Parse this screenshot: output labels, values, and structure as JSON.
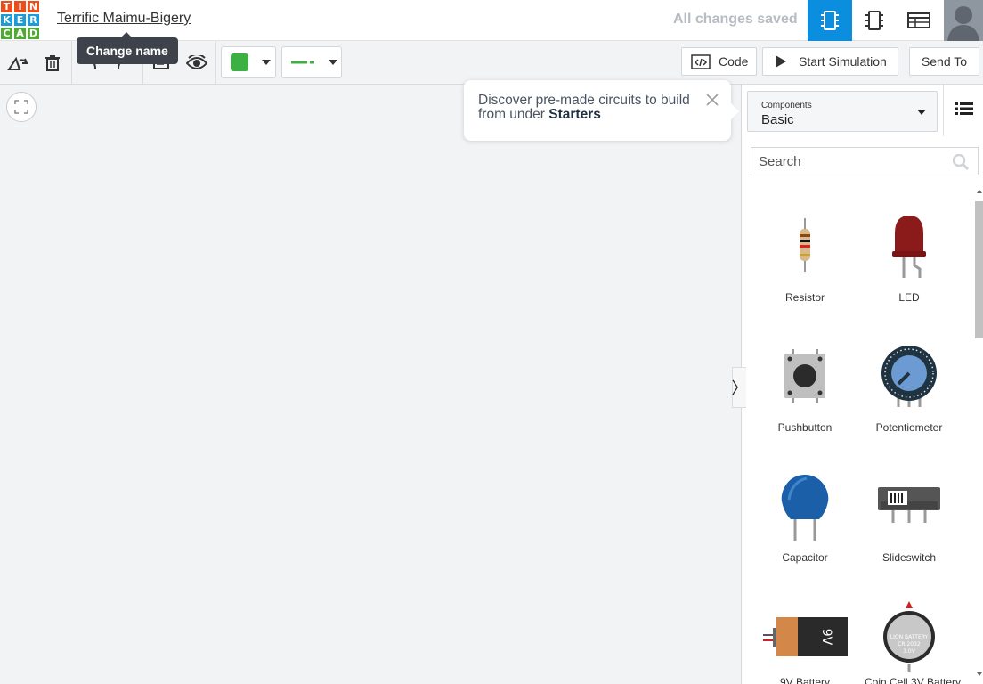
{
  "header": {
    "logo_letters": [
      "T",
      "I",
      "N",
      "K",
      "E",
      "R",
      "C",
      "A",
      "D"
    ],
    "logo_colors": [
      "#e94e1b",
      "#e94e1b",
      "#e94e1b",
      "#1e9ad6",
      "#1e9ad6",
      "#1e9ad6",
      "#51a832",
      "#51a832",
      "#51a832"
    ],
    "title": "Terrific Maimu-Bigery",
    "save_status": "All changes saved",
    "views": [
      "circuit-view-icon",
      "schematic-view-icon",
      "component-list-icon"
    ]
  },
  "tooltip": {
    "text": "Change name"
  },
  "toolbar": {
    "color_value": "#3cb043",
    "code_label": "Code",
    "simulate_label": "Start Simulation",
    "send_label": "Send To"
  },
  "popup": {
    "text": "Discover pre-made circuits to build from under ",
    "highlight": "Starters"
  },
  "sidebar": {
    "components_label": "Components",
    "components_value": "Basic",
    "search_placeholder": "Search",
    "items": [
      {
        "label": "Resistor"
      },
      {
        "label": "LED"
      },
      {
        "label": "Pushbutton"
      },
      {
        "label": "Potentiometer"
      },
      {
        "label": "Capacitor"
      },
      {
        "label": "Slideswitch"
      },
      {
        "label": "9V Battery"
      },
      {
        "label": "Coin Cell 3V Battery"
      }
    ]
  },
  "colors": {
    "accent": "#0b8ede",
    "brand_orange": "#e94e1b"
  }
}
